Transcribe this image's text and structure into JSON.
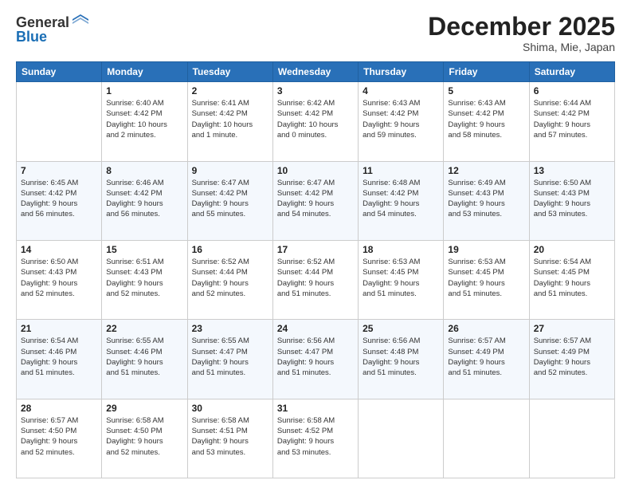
{
  "logo": {
    "general": "General",
    "blue": "Blue"
  },
  "header": {
    "month": "December 2025",
    "location": "Shima, Mie, Japan"
  },
  "weekdays": [
    "Sunday",
    "Monday",
    "Tuesday",
    "Wednesday",
    "Thursday",
    "Friday",
    "Saturday"
  ],
  "weeks": [
    [
      {
        "day": "",
        "info": ""
      },
      {
        "day": "1",
        "info": "Sunrise: 6:40 AM\nSunset: 4:42 PM\nDaylight: 10 hours\nand 2 minutes."
      },
      {
        "day": "2",
        "info": "Sunrise: 6:41 AM\nSunset: 4:42 PM\nDaylight: 10 hours\nand 1 minute."
      },
      {
        "day": "3",
        "info": "Sunrise: 6:42 AM\nSunset: 4:42 PM\nDaylight: 10 hours\nand 0 minutes."
      },
      {
        "day": "4",
        "info": "Sunrise: 6:43 AM\nSunset: 4:42 PM\nDaylight: 9 hours\nand 59 minutes."
      },
      {
        "day": "5",
        "info": "Sunrise: 6:43 AM\nSunset: 4:42 PM\nDaylight: 9 hours\nand 58 minutes."
      },
      {
        "day": "6",
        "info": "Sunrise: 6:44 AM\nSunset: 4:42 PM\nDaylight: 9 hours\nand 57 minutes."
      }
    ],
    [
      {
        "day": "7",
        "info": "Sunrise: 6:45 AM\nSunset: 4:42 PM\nDaylight: 9 hours\nand 56 minutes."
      },
      {
        "day": "8",
        "info": "Sunrise: 6:46 AM\nSunset: 4:42 PM\nDaylight: 9 hours\nand 56 minutes."
      },
      {
        "day": "9",
        "info": "Sunrise: 6:47 AM\nSunset: 4:42 PM\nDaylight: 9 hours\nand 55 minutes."
      },
      {
        "day": "10",
        "info": "Sunrise: 6:47 AM\nSunset: 4:42 PM\nDaylight: 9 hours\nand 54 minutes."
      },
      {
        "day": "11",
        "info": "Sunrise: 6:48 AM\nSunset: 4:42 PM\nDaylight: 9 hours\nand 54 minutes."
      },
      {
        "day": "12",
        "info": "Sunrise: 6:49 AM\nSunset: 4:43 PM\nDaylight: 9 hours\nand 53 minutes."
      },
      {
        "day": "13",
        "info": "Sunrise: 6:50 AM\nSunset: 4:43 PM\nDaylight: 9 hours\nand 53 minutes."
      }
    ],
    [
      {
        "day": "14",
        "info": "Sunrise: 6:50 AM\nSunset: 4:43 PM\nDaylight: 9 hours\nand 52 minutes."
      },
      {
        "day": "15",
        "info": "Sunrise: 6:51 AM\nSunset: 4:43 PM\nDaylight: 9 hours\nand 52 minutes."
      },
      {
        "day": "16",
        "info": "Sunrise: 6:52 AM\nSunset: 4:44 PM\nDaylight: 9 hours\nand 52 minutes."
      },
      {
        "day": "17",
        "info": "Sunrise: 6:52 AM\nSunset: 4:44 PM\nDaylight: 9 hours\nand 51 minutes."
      },
      {
        "day": "18",
        "info": "Sunrise: 6:53 AM\nSunset: 4:45 PM\nDaylight: 9 hours\nand 51 minutes."
      },
      {
        "day": "19",
        "info": "Sunrise: 6:53 AM\nSunset: 4:45 PM\nDaylight: 9 hours\nand 51 minutes."
      },
      {
        "day": "20",
        "info": "Sunrise: 6:54 AM\nSunset: 4:45 PM\nDaylight: 9 hours\nand 51 minutes."
      }
    ],
    [
      {
        "day": "21",
        "info": "Sunrise: 6:54 AM\nSunset: 4:46 PM\nDaylight: 9 hours\nand 51 minutes."
      },
      {
        "day": "22",
        "info": "Sunrise: 6:55 AM\nSunset: 4:46 PM\nDaylight: 9 hours\nand 51 minutes."
      },
      {
        "day": "23",
        "info": "Sunrise: 6:55 AM\nSunset: 4:47 PM\nDaylight: 9 hours\nand 51 minutes."
      },
      {
        "day": "24",
        "info": "Sunrise: 6:56 AM\nSunset: 4:47 PM\nDaylight: 9 hours\nand 51 minutes."
      },
      {
        "day": "25",
        "info": "Sunrise: 6:56 AM\nSunset: 4:48 PM\nDaylight: 9 hours\nand 51 minutes."
      },
      {
        "day": "26",
        "info": "Sunrise: 6:57 AM\nSunset: 4:49 PM\nDaylight: 9 hours\nand 51 minutes."
      },
      {
        "day": "27",
        "info": "Sunrise: 6:57 AM\nSunset: 4:49 PM\nDaylight: 9 hours\nand 52 minutes."
      }
    ],
    [
      {
        "day": "28",
        "info": "Sunrise: 6:57 AM\nSunset: 4:50 PM\nDaylight: 9 hours\nand 52 minutes."
      },
      {
        "day": "29",
        "info": "Sunrise: 6:58 AM\nSunset: 4:50 PM\nDaylight: 9 hours\nand 52 minutes."
      },
      {
        "day": "30",
        "info": "Sunrise: 6:58 AM\nSunset: 4:51 PM\nDaylight: 9 hours\nand 53 minutes."
      },
      {
        "day": "31",
        "info": "Sunrise: 6:58 AM\nSunset: 4:52 PM\nDaylight: 9 hours\nand 53 minutes."
      },
      {
        "day": "",
        "info": ""
      },
      {
        "day": "",
        "info": ""
      },
      {
        "day": "",
        "info": ""
      }
    ]
  ]
}
